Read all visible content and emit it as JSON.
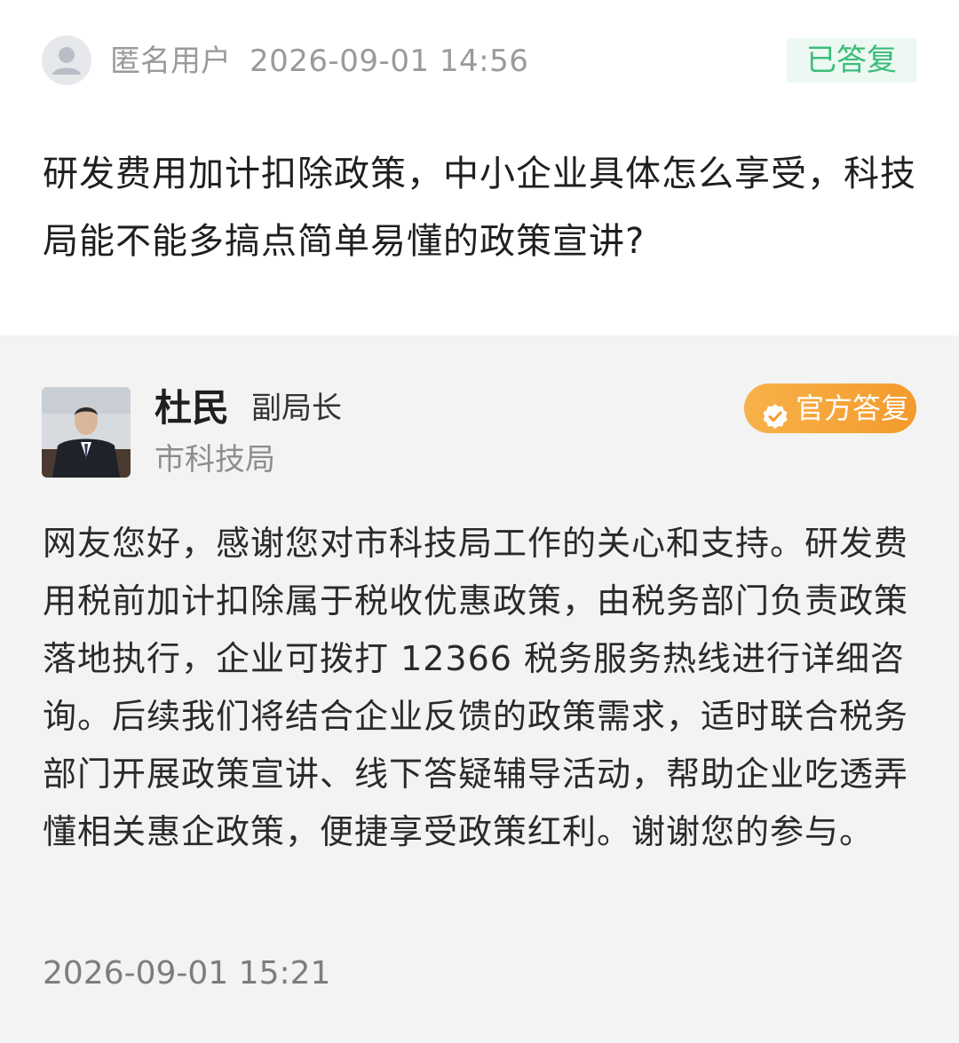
{
  "question": {
    "user_name": "匿名用户",
    "time": "2026-09-01 14:56",
    "status": "已答复",
    "text": "研发费用加计扣除政策，中小企业具体怎么享受，科技局能不能多搞点简单易懂的政策宣讲?"
  },
  "answer": {
    "name": "杜民",
    "title": "副局长",
    "org": "市科技局",
    "badge": "官方答复",
    "text": "网友您好，感谢您对市科技局工作的关心和支持。研发费用税前加计扣除属于税收优惠政策，由税务部门负责政策落地执行，企业可拨打 12366 税务服务热线进行详细咨询。后续我们将结合企业反馈的政策需求，适时联合税务部门开展政策宣讲、线下答疑辅导活动，帮助企业吃透弄懂相关惠企政策，便捷享受政策红利。谢谢您的参与。",
    "time": "2026-09-01 15:21"
  },
  "colors": {
    "status_green": "#3bbd7a",
    "badge_orange": "#f49a2c",
    "answer_bg": "#f3f3f3"
  }
}
